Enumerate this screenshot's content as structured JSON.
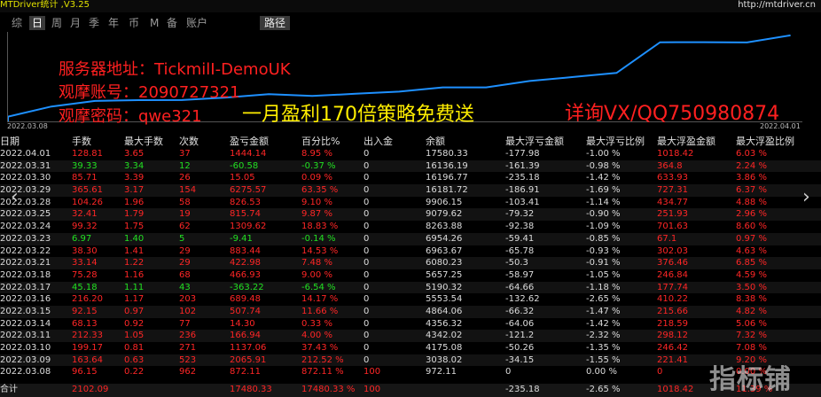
{
  "app": {
    "title": "MTDriver统计 ,V3.25",
    "url": "http://mtdriver.cn"
  },
  "tabs": [
    {
      "label": "综"
    },
    {
      "label": "日",
      "active": true
    },
    {
      "label": "周"
    },
    {
      "label": "月"
    },
    {
      "label": "季"
    },
    {
      "label": "年"
    },
    {
      "label": "币"
    },
    {
      "label": "M"
    },
    {
      "label": "备"
    },
    {
      "label": "账户"
    }
  ],
  "path_button": "路径",
  "chart": {
    "x_start": "2022.03.08",
    "x_end": "2022.04.01",
    "line_color": "#1e90ff",
    "balance": [
      972.11,
      3038.02,
      4175.08,
      4342.02,
      4356.32,
      4864.06,
      5553.54,
      5190.32,
      5657.25,
      6080.23,
      6963.67,
      6954.26,
      8263.88,
      9079.62,
      9906.15,
      16181.72,
      16196.77,
      16136.19,
      17580.33
    ]
  },
  "overlay": {
    "server": "服务器地址：TickmilI-DemoUK",
    "account": "观摩账号：2090727321",
    "password": "观摩密码：qwe321",
    "slogan": "一月盈利170倍策略免费送",
    "contact": "详询VX/QQ750980874"
  },
  "columns": [
    "日期",
    "手数",
    "最大手数",
    "次数",
    "盈亏金额",
    "百分比%",
    "出入金",
    "余额",
    "最大浮亏金额",
    "最大浮亏比例",
    "最大浮盈金额",
    "最大浮盈比例"
  ],
  "rows": [
    {
      "date": "2022.04.01",
      "lots": "128.81",
      "maxlots": "3.65",
      "count": "37",
      "pl": "1444.14",
      "pct": "8.95 %",
      "io": "0",
      "bal": "17580.33",
      "mfl": "-177.98",
      "mflp": "-1.00 %",
      "mfp": "1018.42",
      "mfpp": "6.03 %",
      "c": "red"
    },
    {
      "date": "2022.03.31",
      "lots": "39.33",
      "maxlots": "3.34",
      "count": "12",
      "pl": "-60.58",
      "pct": "-0.37 %",
      "io": "0",
      "bal": "16136.19",
      "mfl": "-161.39",
      "mflp": "-0.98 %",
      "mfp": "364.8",
      "mfpp": "2.24 %",
      "c": "green"
    },
    {
      "date": "2022.03.30",
      "lots": "85.71",
      "maxlots": "3.39",
      "count": "26",
      "pl": "15.05",
      "pct": "0.09 %",
      "io": "0",
      "bal": "16196.77",
      "mfl": "-235.18",
      "mflp": "-1.42 %",
      "mfp": "633.93",
      "mfpp": "3.86 %",
      "c": "red"
    },
    {
      "date": "2022.03.29",
      "lots": "365.61",
      "maxlots": "3.17",
      "count": "154",
      "pl": "6275.57",
      "pct": "63.35 %",
      "io": "0",
      "bal": "16181.72",
      "mfl": "-186.91",
      "mflp": "-1.69 %",
      "mfp": "727.31",
      "mfpp": "6.37 %",
      "c": "red"
    },
    {
      "date": "2022.03.28",
      "lots": "104.26",
      "maxlots": "1.96",
      "count": "58",
      "pl": "826.53",
      "pct": "9.10 %",
      "io": "0",
      "bal": "9906.15",
      "mfl": "-103.41",
      "mflp": "-1.14 %",
      "mfp": "434.77",
      "mfpp": "4.88 %",
      "c": "red"
    },
    {
      "date": "2022.03.25",
      "lots": "32.41",
      "maxlots": "1.79",
      "count": "19",
      "pl": "815.74",
      "pct": "9.87 %",
      "io": "0",
      "bal": "9079.62",
      "mfl": "-79.32",
      "mflp": "-0.90 %",
      "mfp": "251.93",
      "mfpp": "2.96 %",
      "c": "red"
    },
    {
      "date": "2022.03.24",
      "lots": "99.32",
      "maxlots": "1.75",
      "count": "62",
      "pl": "1309.62",
      "pct": "18.83 %",
      "io": "0",
      "bal": "8263.88",
      "mfl": "-92.38",
      "mflp": "-1.09 %",
      "mfp": "701.63",
      "mfpp": "8.60 %",
      "c": "red"
    },
    {
      "date": "2022.03.23",
      "lots": "6.97",
      "maxlots": "1.40",
      "count": "5",
      "pl": "-9.41",
      "pct": "-0.14 %",
      "io": "0",
      "bal": "6954.26",
      "mfl": "-59.41",
      "mflp": "-0.85 %",
      "mfp": "67.1",
      "mfpp": "0.97 %",
      "c": "green"
    },
    {
      "date": "2022.03.22",
      "lots": "38.30",
      "maxlots": "1.41",
      "count": "29",
      "pl": "883.44",
      "pct": "14.53 %",
      "io": "0",
      "bal": "6963.67",
      "mfl": "-65.78",
      "mflp": "-0.93 %",
      "mfp": "302.03",
      "mfpp": "4.63 %",
      "c": "red"
    },
    {
      "date": "2022.03.21",
      "lots": "33.14",
      "maxlots": "1.22",
      "count": "29",
      "pl": "422.98",
      "pct": "7.48 %",
      "io": "0",
      "bal": "6080.23",
      "mfl": "-50.3",
      "mflp": "-0.91 %",
      "mfp": "376.46",
      "mfpp": "6.85 %",
      "c": "red"
    },
    {
      "date": "2022.03.18",
      "lots": "75.28",
      "maxlots": "1.16",
      "count": "68",
      "pl": "466.93",
      "pct": "9.00 %",
      "io": "0",
      "bal": "5657.25",
      "mfl": "-58.97",
      "mflp": "-1.05 %",
      "mfp": "246.84",
      "mfpp": "4.59 %",
      "c": "red"
    },
    {
      "date": "2022.03.17",
      "lots": "45.18",
      "maxlots": "1.11",
      "count": "43",
      "pl": "-363.22",
      "pct": "-6.54 %",
      "io": "0",
      "bal": "5190.32",
      "mfl": "-64.66",
      "mflp": "-1.18 %",
      "mfp": "177.74",
      "mfpp": "3.50 %",
      "c": "green"
    },
    {
      "date": "2022.03.16",
      "lots": "216.20",
      "maxlots": "1.17",
      "count": "203",
      "pl": "689.48",
      "pct": "14.17 %",
      "io": "0",
      "bal": "5553.54",
      "mfl": "-132.62",
      "mflp": "-2.65 %",
      "mfp": "410.22",
      "mfpp": "8.38 %",
      "c": "red"
    },
    {
      "date": "2022.03.15",
      "lots": "92.15",
      "maxlots": "0.97",
      "count": "102",
      "pl": "507.74",
      "pct": "11.66 %",
      "io": "0",
      "bal": "4864.06",
      "mfl": "-66.32",
      "mflp": "-1.47 %",
      "mfp": "215.66",
      "mfpp": "4.82 %",
      "c": "red"
    },
    {
      "date": "2022.03.14",
      "lots": "68.13",
      "maxlots": "0.92",
      "count": "77",
      "pl": "14.30",
      "pct": "0.33 %",
      "io": "0",
      "bal": "4356.32",
      "mfl": "-64.06",
      "mflp": "-1.42 %",
      "mfp": "218.59",
      "mfpp": "5.06 %",
      "c": "red"
    },
    {
      "date": "2022.03.11",
      "lots": "212.33",
      "maxlots": "1.05",
      "count": "236",
      "pl": "166.94",
      "pct": "4.00 %",
      "io": "0",
      "bal": "4342.02",
      "mfl": "-121.2",
      "mflp": "-2.32 %",
      "mfp": "298.12",
      "mfpp": "7.32 %",
      "c": "red"
    },
    {
      "date": "2022.03.10",
      "lots": "199.17",
      "maxlots": "0.81",
      "count": "271",
      "pl": "1137.06",
      "pct": "37.43 %",
      "io": "0",
      "bal": "4175.08",
      "mfl": "-50.26",
      "mflp": "-1.35 %",
      "mfp": "246.42",
      "mfpp": "7.08 %",
      "c": "red"
    },
    {
      "date": "2022.03.09",
      "lots": "163.64",
      "maxlots": "0.63",
      "count": "523",
      "pl": "2065.91",
      "pct": "212.52 %",
      "io": "0",
      "bal": "3038.02",
      "mfl": "-34.15",
      "mflp": "-1.55 %",
      "mfp": "221.41",
      "mfpp": "9.20 %",
      "c": "red"
    },
    {
      "date": "2022.03.08",
      "lots": "96.15",
      "maxlots": "0.22",
      "count": "962",
      "pl": "872.11",
      "pct": "872.11 %",
      "io": "100",
      "bal": "972.11",
      "mfl": "0",
      "mflp": "0.00 %",
      "mfp": "0",
      "mfpp": "0.00 %",
      "c": "red"
    }
  ],
  "total": {
    "label": "合计",
    "lots": "2102.09",
    "pl": "17480.33",
    "pct": "17480.33 %",
    "io": "100",
    "mfl": "-235.18",
    "mflp": "-2.65 %",
    "mfp": "1018.42",
    "mfpp": "11.39 %"
  },
  "nav": {
    "left": "‹",
    "right": "›"
  },
  "watermark": "指标铺"
}
